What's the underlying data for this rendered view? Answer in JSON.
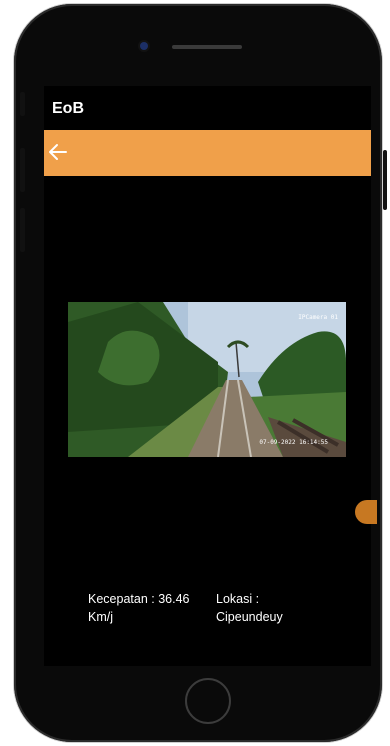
{
  "app": {
    "title": "EoB"
  },
  "toolbar": {
    "back_icon": "arrow-left-icon",
    "color": "#f0a04a"
  },
  "camera": {
    "label": "IPCamera 01",
    "timestamp": "07-09-2022 16:14:55"
  },
  "info": {
    "speed_label": "Kecepatan : 36.46",
    "speed_unit": "Km/j",
    "location_label": "Lokasi :",
    "location_value": "Cipeundeuy"
  }
}
